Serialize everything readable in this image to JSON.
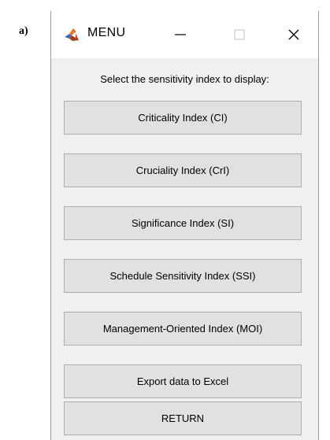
{
  "panel_label": "a)",
  "window": {
    "title": "MENU",
    "app_icon": "matlab-icon",
    "controls": {
      "minimize_icon": "minimize-icon",
      "maximize_icon": "maximize-icon",
      "close_icon": "close-icon"
    }
  },
  "prompt": "Select the sensitivity index to display:",
  "buttons": [
    {
      "label": "Criticality Index (CI)"
    },
    {
      "label": "Cruciality Index (CrI)"
    },
    {
      "label": "Significance Index (SI)"
    },
    {
      "label": "Schedule Sensitivity Index (SSI)"
    },
    {
      "label": "Management-Oriented Index (MOI)"
    },
    {
      "label": "Export data to Excel"
    },
    {
      "label": "RETURN"
    }
  ],
  "colors": {
    "window_background": "#f0f0f0",
    "titlebar_background": "#ffffff",
    "button_face": "#e1e1e1",
    "button_border": "#adadad"
  }
}
